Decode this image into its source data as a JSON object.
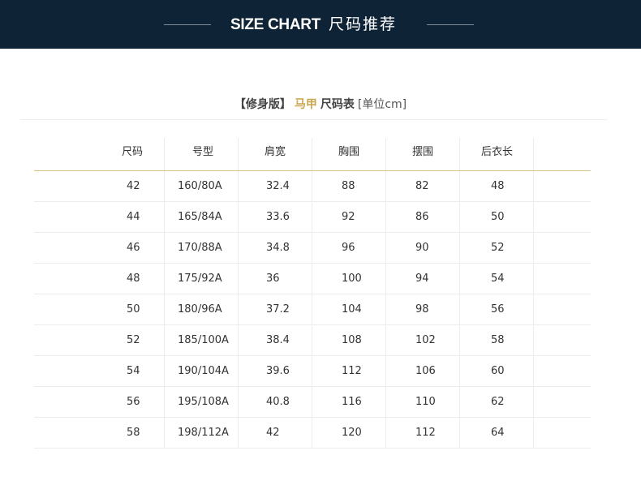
{
  "header": {
    "title_en": "SIZE CHART",
    "title_cn": "尺码推荐"
  },
  "subtitle": {
    "fit": "【修身版】",
    "product": "马甲",
    "table_name": "尺码表",
    "unit": "[单位cm]"
  },
  "table": {
    "columns": [
      "尺码",
      "号型",
      "肩宽",
      "胸围",
      "摆围",
      "后衣长",
      ""
    ],
    "rows": [
      [
        "42",
        "160/80A",
        "32.4",
        "88",
        "82",
        "48",
        ""
      ],
      [
        "44",
        "165/84A",
        "33.6",
        "92",
        "86",
        "50",
        ""
      ],
      [
        "46",
        "170/88A",
        "34.8",
        "96",
        "90",
        "52",
        ""
      ],
      [
        "48",
        "175/92A",
        "36",
        "100",
        "94",
        "54",
        ""
      ],
      [
        "50",
        "180/96A",
        "37.2",
        "104",
        "98",
        "56",
        ""
      ],
      [
        "52",
        "185/100A",
        "38.4",
        "108",
        "102",
        "58",
        ""
      ],
      [
        "54",
        "190/104A",
        "39.6",
        "112",
        "106",
        "60",
        ""
      ],
      [
        "56",
        "195/108A",
        "40.8",
        "116",
        "110",
        "62",
        ""
      ],
      [
        "58",
        "198/112A",
        "42",
        "120",
        "112",
        "64",
        ""
      ]
    ]
  },
  "colors": {
    "header_bg": "#0f2336",
    "accent_gold": "#c9a64f",
    "header_rule": "#d9c386"
  }
}
